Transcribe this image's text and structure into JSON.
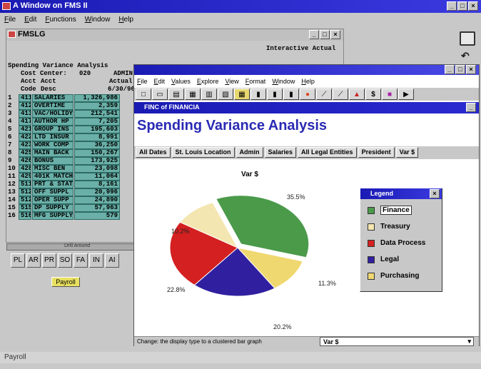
{
  "outer": {
    "title": "A Window on FMS II",
    "menu": [
      "File",
      "Edit",
      "Functions",
      "Window",
      "Help"
    ],
    "status": "Payroll"
  },
  "fmslg": {
    "title": "FMSLG",
    "header_right": "Interactive Actual",
    "report_title": "Spending Variance Analysis",
    "cost_center_label": "Cost Center:",
    "cost_center_value": "020",
    "cost_center_name": "ADMIN",
    "col_acct1": "Acct",
    "col_acct2": "Acct",
    "col_actual": "Actual",
    "col_code": "Code",
    "col_desc": "Desc",
    "col_date": "6/30/96",
    "rows": [
      {
        "n": "1",
        "code": "411",
        "desc": "SALARIES",
        "val": "1,326,986"
      },
      {
        "n": "2",
        "code": "412",
        "desc": "OVERTIME",
        "val": "2,359"
      },
      {
        "n": "3",
        "code": "413",
        "desc": "VAC/HOLIDY",
        "val": "212,541"
      },
      {
        "n": "4",
        "code": "417",
        "desc": "AUTHOR HP",
        "val": "7,205"
      },
      {
        "n": "5",
        "code": "421",
        "desc": "GROUP INS",
        "val": "195,603"
      },
      {
        "n": "6",
        "code": "422",
        "desc": "LTD INSUR",
        "val": "8,991"
      },
      {
        "n": "7",
        "code": "423",
        "desc": "WORK COMP",
        "val": "36,250"
      },
      {
        "n": "8",
        "code": "425",
        "desc": "MAIN BACK",
        "val": "150,267"
      },
      {
        "n": "9",
        "code": "426",
        "desc": "BONUS",
        "val": "173,925"
      },
      {
        "n": "10",
        "code": "428",
        "desc": "MISC BEN",
        "val": "23,098"
      },
      {
        "n": "11",
        "code": "429",
        "desc": "401K MATCH",
        "val": "11,064"
      },
      {
        "n": "12",
        "code": "511",
        "desc": "PRT & STAT",
        "val": "8,161"
      },
      {
        "n": "13",
        "code": "512",
        "desc": "OFF SUPPL",
        "val": "20,996"
      },
      {
        "n": "14",
        "code": "512",
        "desc": "OPER SUPP",
        "val": "24,890"
      },
      {
        "n": "15",
        "code": "515",
        "desc": "DP SUPPLY",
        "val": "57,963"
      },
      {
        "n": "16",
        "code": "516",
        "desc": "MFG SUPPLY",
        "val": "579"
      }
    ],
    "drill_label": "Drill Around",
    "buttons": [
      "PL",
      "AR",
      "PR",
      "SO",
      "FA",
      "IN",
      "AI"
    ],
    "payroll_button": "Payroll"
  },
  "app": {
    "menu": [
      "File",
      "Edit",
      "Values",
      "Explore",
      "View",
      "Format",
      "Window",
      "Help"
    ],
    "doc_title": "FINC of FINANCIA",
    "heading": "Spending Variance Analysis",
    "filters": [
      "All Dates",
      "St. Louis Location",
      "Admin",
      "Salaries",
      "All Legal Entities",
      "President",
      "Var $"
    ],
    "status": "Change: the display type to a clustered bar graph",
    "status_select": "Var $"
  },
  "chart_data": {
    "type": "pie",
    "title": "Var $",
    "categories": [
      "Finance",
      "Treasury",
      "Data Process",
      "Legal",
      "Purchasing"
    ],
    "values": [
      35.5,
      10.2,
      22.8,
      20.2,
      11.3
    ],
    "labels": [
      "35.5%",
      "10.2%",
      "22.8%",
      "20.2%",
      "11.3%"
    ],
    "colors": [
      "#4a9a4a",
      "#f4e6b0",
      "#d42020",
      "#3020a0",
      "#f0d870"
    ],
    "legend_title": "Legend",
    "legend_position": "right"
  }
}
